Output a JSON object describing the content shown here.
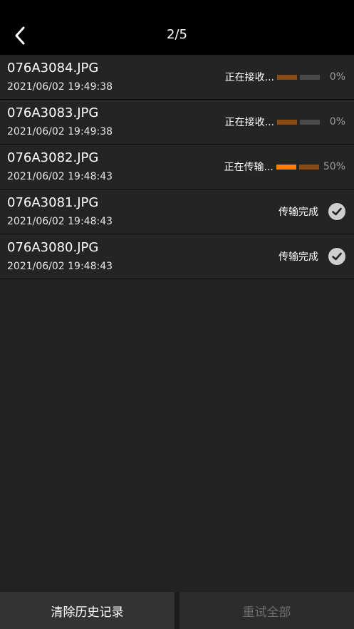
{
  "header": {
    "title": "2/5",
    "back_icon": "chevron-left-icon"
  },
  "colors": {
    "progress_active": "#ff7d0a",
    "progress_dim": "#8a4a14",
    "progress_empty": "#4a4a4a",
    "check_bg": "#cfcfcf"
  },
  "files": [
    {
      "name": "076A3084.JPG",
      "time": "2021/06/02 19:49:38",
      "status": "正在接收...",
      "state": "receiving",
      "percent": "0%",
      "progress": 0
    },
    {
      "name": "076A3083.JPG",
      "time": "2021/06/02 19:49:38",
      "status": "正在接收...",
      "state": "receiving",
      "percent": "0%",
      "progress": 0
    },
    {
      "name": "076A3082.JPG",
      "time": "2021/06/02 19:48:43",
      "status": "正在传输...",
      "state": "transferring",
      "percent": "50%",
      "progress": 0.5
    },
    {
      "name": "076A3081.JPG",
      "time": "2021/06/02 19:48:43",
      "status": "传输完成",
      "state": "done"
    },
    {
      "name": "076A3080.JPG",
      "time": "2021/06/02 19:48:43",
      "status": "传输完成",
      "state": "done"
    }
  ],
  "footer": {
    "clear_label": "清除历史记录",
    "retry_label": "重试全部"
  }
}
